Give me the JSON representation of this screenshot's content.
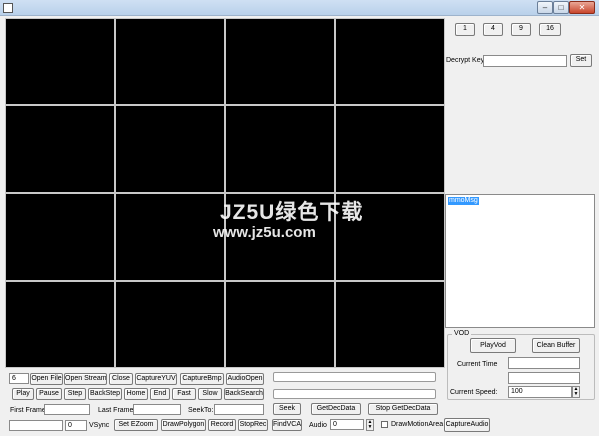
{
  "window": {
    "buttons": {
      "minimize": "–",
      "maximize": "□",
      "close": "✕"
    },
    "accent": "#b9d1ea"
  },
  "split_buttons": [
    "1",
    "4",
    "9",
    "16"
  ],
  "decrypt": {
    "label": "Decrypt Key",
    "value": "",
    "set_label": "Set"
  },
  "message_box": {
    "selected_text": "mmoMsg"
  },
  "vod": {
    "group_label": "VOD",
    "play_label": "PlayVod",
    "clean_label": "Clean Buffer",
    "current_time_label": "Current Time",
    "current_time_value": "",
    "current_time_value2": "",
    "speed_label": "Current Speed:",
    "speed_value": "100"
  },
  "row1": {
    "index_value": "6",
    "open_file": "Open File",
    "open_stream": "Open Stream",
    "close": "Close",
    "capture_yuv": "CaptureYUV",
    "capture_bmp": "CaptureBmp",
    "audio_open": "AudioOpen"
  },
  "row2": {
    "play": "Play",
    "pause": "Pause",
    "step": "Step",
    "backstep": "BackStep",
    "home": "Home",
    "end": "End",
    "fast": "Fast",
    "slow": "Slow",
    "backsearch": "BackSearch"
  },
  "row3": {
    "first_frame_label": "First Frame:",
    "first_frame_value": "",
    "last_frame_label": "Last Frame:",
    "last_frame_value": "",
    "seekto_label": "SeekTo:",
    "seekto_value": "",
    "seek": "Seek",
    "get_dec_data": "GetDecData",
    "stop_get_dec_data": "Stop GetDecData"
  },
  "row4": {
    "blank_value": "",
    "vsync_value": "0",
    "vsync_label": "VSync",
    "set_ezoom": "Set EZoom",
    "draw_polygon": "DrawPolygon",
    "record": "Record",
    "stop_rec": "StopRec",
    "find_vca": "FindVCA",
    "audio_label": "Audio",
    "audio_value": "0",
    "draw_motion_area": "DrawMotionArea",
    "capture_audio": "CaptureAudio"
  },
  "watermark": {
    "line1": "JZ5U绿色下载",
    "line2": "www.jz5u.com"
  }
}
